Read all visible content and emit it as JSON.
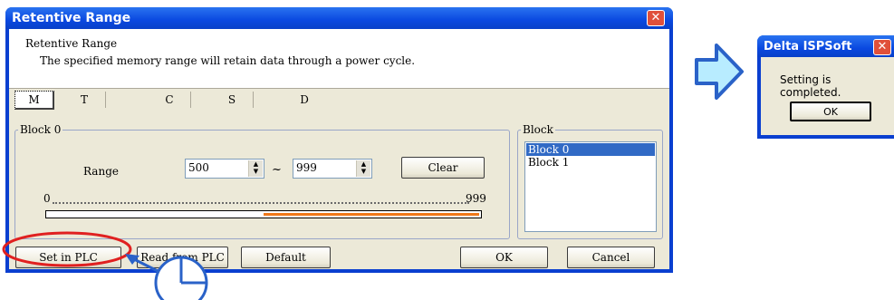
{
  "dialog": {
    "title": "Retentive Range",
    "close_glyph": "✕",
    "header_title": "Retentive Range",
    "header_desc": "The specified memory range will retain data through a power cycle.",
    "tabs": [
      "M",
      "T",
      "C",
      "S",
      "D"
    ],
    "selected_tab": "M",
    "block_group_label": "Block 0",
    "range_label": "Range",
    "range_start": "500",
    "range_separator": "~",
    "range_end": "999",
    "clear_label": "Clear",
    "scale_min": "0",
    "scale_max": "999",
    "retained_fraction_start": 0.5,
    "retained_fraction_end": 1.0,
    "block_list_label": "Block",
    "blocks": [
      "Block 0",
      "Block 1"
    ],
    "selected_block": "Block 0",
    "buttons": {
      "set_in_plc": "Set in PLC",
      "read_from_plc": "Read from PLC",
      "default": "Default",
      "ok": "OK",
      "cancel": "Cancel"
    }
  },
  "completed_dialog": {
    "title": "Delta ISPSoft",
    "close_glyph": "✕",
    "message": "Setting is completed.",
    "ok": "OK"
  },
  "colors": {
    "titlebar": "#0a48e0",
    "dialog_face": "#ece9d8",
    "range_bar": "#f07818",
    "highlight_ring": "#e02020",
    "arrow_fill": "#b8ecff",
    "arrow_stroke": "#2a62c8",
    "selection": "#316ac5"
  },
  "icons": [
    "close-icon",
    "spin-up-icon",
    "spin-down-icon",
    "arrow-right-icon",
    "click-cursor-icon"
  ]
}
